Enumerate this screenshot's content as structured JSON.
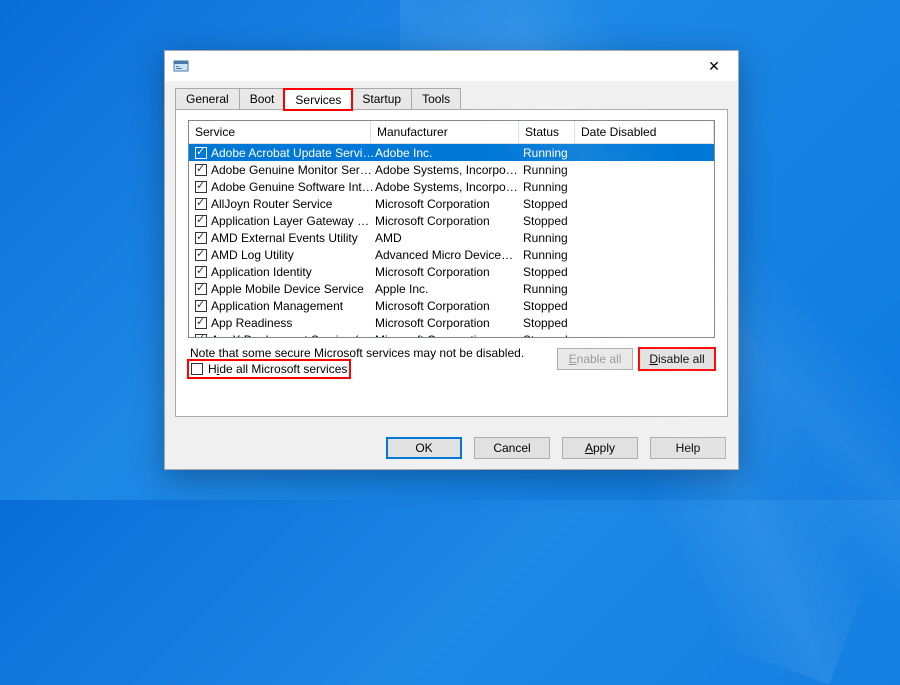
{
  "window": {
    "title": "",
    "close_label": "✕"
  },
  "tabs": {
    "general": "General",
    "boot": "Boot",
    "services": "Services",
    "startup": "Startup",
    "tools": "Tools"
  },
  "columns": {
    "service": "Service",
    "manufacturer": "Manufacturer",
    "status": "Status",
    "date_disabled": "Date Disabled"
  },
  "rows": [
    {
      "svc": "Adobe Acrobat Update Service",
      "mfr": "Adobe Inc.",
      "sta": "Running",
      "sel": true
    },
    {
      "svc": "Adobe Genuine Monitor Service",
      "mfr": "Adobe Systems, Incorpora...",
      "sta": "Running"
    },
    {
      "svc": "Adobe Genuine Software Integri…",
      "mfr": "Adobe Systems, Incorpora...",
      "sta": "Running"
    },
    {
      "svc": "AllJoyn Router Service",
      "mfr": "Microsoft Corporation",
      "sta": "Stopped"
    },
    {
      "svc": "Application Layer Gateway Service",
      "mfr": "Microsoft Corporation",
      "sta": "Stopped"
    },
    {
      "svc": "AMD External Events Utility",
      "mfr": "AMD",
      "sta": "Running"
    },
    {
      "svc": "AMD Log Utility",
      "mfr": "Advanced Micro Devices, I...",
      "sta": "Running"
    },
    {
      "svc": "Application Identity",
      "mfr": "Microsoft Corporation",
      "sta": "Stopped"
    },
    {
      "svc": "Apple Mobile Device Service",
      "mfr": "Apple Inc.",
      "sta": "Running"
    },
    {
      "svc": "Application Management",
      "mfr": "Microsoft Corporation",
      "sta": "Stopped"
    },
    {
      "svc": "App Readiness",
      "mfr": "Microsoft Corporation",
      "sta": "Stopped"
    },
    {
      "svc": "AppX Deployment Service (AppX…",
      "mfr": "Microsoft Corporation",
      "sta": "Stopped"
    }
  ],
  "note": "Note that some secure Microsoft services may not be disabled.",
  "hide_label_pre": "H",
  "hide_label_u": "i",
  "hide_label_post": "de all Microsoft services",
  "enable_all_pre": "",
  "enable_all_u": "E",
  "enable_all_post": "nable all",
  "disable_all_pre": "",
  "disable_all_u": "D",
  "disable_all_post": "isable all",
  "buttons": {
    "ok": "OK",
    "cancel": "Cancel",
    "apply_pre": "",
    "apply_u": "A",
    "apply_post": "pply",
    "help": "Help"
  }
}
